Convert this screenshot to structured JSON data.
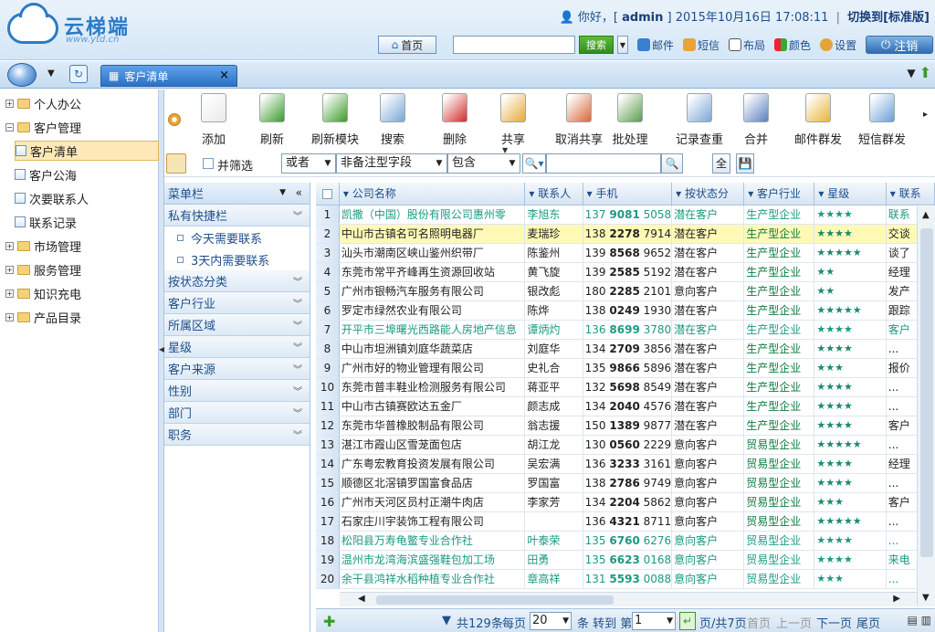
{
  "header": {
    "logo_title": "云梯端",
    "logo_url": "www.ytd.cn",
    "greeting": "你好，",
    "username": "admin",
    "datetime": "2015年10月16日 17:08:11",
    "switch_label": "切换到[标准版]",
    "home_label": "首页",
    "search_label": "搜索",
    "links": {
      "mail": "邮件",
      "sms": "短信",
      "layout": "布局",
      "color": "颜色",
      "settings": "设置"
    },
    "logout_label": "注销"
  },
  "tabs": {
    "active": "客户清单"
  },
  "sidebar": {
    "items": [
      {
        "label": "个人办公",
        "type": "folder"
      },
      {
        "label": "客户管理",
        "type": "folder-open"
      },
      {
        "label": "客户清单",
        "type": "doc"
      },
      {
        "label": "客户公海",
        "type": "doc"
      },
      {
        "label": "次要联系人",
        "type": "doc"
      },
      {
        "label": "联系记录",
        "type": "doc"
      },
      {
        "label": "市场管理",
        "type": "folder"
      },
      {
        "label": "服务管理",
        "type": "folder"
      },
      {
        "label": "知识充电",
        "type": "folder"
      },
      {
        "label": "产品目录",
        "type": "folder"
      }
    ]
  },
  "toolbar": {
    "buttons": [
      {
        "label": "添加",
        "icon": "add-doc-icon",
        "color": "#e9e9e9"
      },
      {
        "label": "刷新",
        "icon": "refresh-icon",
        "color": "#3a9a2a"
      },
      {
        "label": "刷新模块",
        "icon": "refresh-module-icon",
        "color": "#3a9a2a"
      },
      {
        "label": "搜索",
        "icon": "magnifier-icon",
        "color": "#7ba6d4"
      },
      {
        "label": "删除",
        "icon": "delete-icon",
        "color": "#d12c2c"
      },
      {
        "label": "共享",
        "icon": "share-icon",
        "color": "#e6a93a"
      },
      {
        "label": "取消共享",
        "icon": "unshare-icon",
        "color": "#d8673a"
      },
      {
        "label": "批处理",
        "icon": "batch-icon",
        "color": "#5c9b4b"
      },
      {
        "label": "记录查重",
        "icon": "dup-check-icon",
        "color": "#7ba6d4"
      },
      {
        "label": "合并",
        "icon": "merge-icon",
        "color": "#5b7fbf"
      },
      {
        "label": "邮件群发",
        "icon": "mail-send-icon",
        "color": "#e8b33a"
      },
      {
        "label": "短信群发",
        "icon": "sms-send-icon",
        "color": "#6a9ed6"
      }
    ]
  },
  "filter": {
    "checkbox_label": "并筛选",
    "logic": "或者",
    "field": "非备注型字段",
    "operator": "包含",
    "all_label": "全"
  },
  "menu": {
    "title": "菜单栏",
    "sections": [
      {
        "label": "私有快捷栏",
        "subs": [
          "今天需要联系",
          "3天内需要联系"
        ]
      },
      {
        "label": "按状态分类"
      },
      {
        "label": "客户行业"
      },
      {
        "label": "所属区域"
      },
      {
        "label": "星级"
      },
      {
        "label": "客户来源"
      },
      {
        "label": "性别"
      },
      {
        "label": "部门"
      },
      {
        "label": "职务"
      }
    ]
  },
  "grid": {
    "columns": [
      "公司名称",
      "联系人",
      "手机",
      "按状态分",
      "客户行业",
      "星级",
      "联系"
    ],
    "rows": [
      {
        "n": "1",
        "company": "凯撒（中国）股份有限公司惠州零",
        "contact": "李旭东",
        "p1": "137",
        "p2": "9081",
        "p3": "5058",
        "status": "潜在客户",
        "industry": "生产型企业",
        "star": "★★★★",
        "extra": "联系",
        "style": "teal"
      },
      {
        "n": "2",
        "company": "中山市古镇名可名照明电器厂",
        "contact": "麦瑞珍",
        "p1": "138",
        "p2": "2278",
        "p3": "7914",
        "status": "潜在客户",
        "industry": "生产型企业",
        "star": "★★★★",
        "extra": "交谈",
        "style": "hl"
      },
      {
        "n": "3",
        "company": "汕头市潮南区峡山鉴州织带厂",
        "contact": "陈鉴州",
        "p1": "139",
        "p2": "8568",
        "p3": "9652",
        "status": "潜在客户",
        "industry": "生产型企业",
        "star": "★★★★★",
        "extra": "谈了",
        "style": ""
      },
      {
        "n": "4",
        "company": "东莞市常平齐峰再生资源回收站",
        "contact": "黄飞旋",
        "p1": "139",
        "p2": "2585",
        "p3": "5192",
        "status": "潜在客户",
        "industry": "生产型企业",
        "star": "★★",
        "extra": "经理",
        "style": ""
      },
      {
        "n": "5",
        "company": "广州市银畅汽车服务有限公司",
        "contact": "银改彪",
        "p1": "180",
        "p2": "2285",
        "p3": "2101",
        "status": "意向客户",
        "industry": "生产型企业",
        "star": "★★",
        "extra": "发产",
        "style": ""
      },
      {
        "n": "6",
        "company": "罗定市绿然农业有限公司",
        "contact": "陈烨",
        "p1": "138",
        "p2": "0249",
        "p3": "1930",
        "status": "潜在客户",
        "industry": "生产型企业",
        "star": "★★★★★",
        "extra": "跟踪",
        "style": ""
      },
      {
        "n": "7",
        "company": "开平市三埠曙光西路能人房地产信息",
        "contact": "谭炳灼",
        "p1": "136",
        "p2": "8699",
        "p3": "3780",
        "status": "潜在客户",
        "industry": "生产型企业",
        "star": "★★★★",
        "extra": "客户",
        "style": "teal"
      },
      {
        "n": "8",
        "company": "中山市坦洲镇刘庭华蔬菜店",
        "contact": "刘庭华",
        "p1": "134",
        "p2": "2709",
        "p3": "3856",
        "status": "潜在客户",
        "industry": "生产型企业",
        "star": "★★★★",
        "extra": "...",
        "style": ""
      },
      {
        "n": "9",
        "company": "广州市好的物业管理有限公司",
        "contact": "史礼合",
        "p1": "135",
        "p2": "9866",
        "p3": "5896",
        "status": "潜在客户",
        "industry": "生产型企业",
        "star": "★★★",
        "extra": "报价",
        "style": ""
      },
      {
        "n": "10",
        "company": "东莞市普丰鞋业检测服务有限公司",
        "contact": "蒋亚平",
        "p1": "132",
        "p2": "5698",
        "p3": "8549",
        "status": "潜在客户",
        "industry": "生产型企业",
        "star": "★★★★",
        "extra": "...",
        "style": ""
      },
      {
        "n": "11",
        "company": "中山市古镇赛欧达五金厂",
        "contact": "颜志成",
        "p1": "134",
        "p2": "2040",
        "p3": "4576",
        "status": "潜在客户",
        "industry": "生产型企业",
        "star": "★★★★",
        "extra": "...",
        "style": ""
      },
      {
        "n": "12",
        "company": "东莞市华普橡胶制品有限公司",
        "contact": "翁志援",
        "p1": "150",
        "p2": "1389",
        "p3": "9877",
        "status": "潜在客户",
        "industry": "生产型企业",
        "star": "★★★★",
        "extra": "客户",
        "style": ""
      },
      {
        "n": "13",
        "company": "湛江市霞山区雪茏面包店",
        "contact": "胡江龙",
        "p1": "130",
        "p2": "0560",
        "p3": "2229",
        "status": "意向客户",
        "industry": "贸易型企业",
        "star": "★★★★★",
        "extra": "...",
        "style": ""
      },
      {
        "n": "14",
        "company": "广东粤宏教育投资发展有限公司",
        "contact": "吴宏满",
        "p1": "136",
        "p2": "3233",
        "p3": "3161",
        "status": "意向客户",
        "industry": "贸易型企业",
        "star": "★★★★",
        "extra": "经理",
        "style": ""
      },
      {
        "n": "15",
        "company": "顺德区北滘镇罗国富食品店",
        "contact": "罗国富",
        "p1": "138",
        "p2": "2786",
        "p3": "9749",
        "status": "意向客户",
        "industry": "贸易型企业",
        "star": "★★★★",
        "extra": "...",
        "style": ""
      },
      {
        "n": "16",
        "company": "广州市天河区员村正潮牛肉店",
        "contact": "李家芳",
        "p1": "134",
        "p2": "2204",
        "p3": "5862",
        "status": "意向客户",
        "industry": "贸易型企业",
        "star": "★★★",
        "extra": "客户",
        "style": ""
      },
      {
        "n": "17",
        "company": "石家庄川宇装饰工程有限公司",
        "contact": "",
        "p1": "136",
        "p2": "4321",
        "p3": "8711",
        "status": "意向客户",
        "industry": "贸易型企业",
        "star": "★★★★★",
        "extra": "...",
        "style": ""
      },
      {
        "n": "18",
        "company": "松阳县万寿龟鳖专业合作社",
        "contact": "叶泰荣",
        "p1": "135",
        "p2": "6760",
        "p3": "6276",
        "status": "意向客户",
        "industry": "贸易型企业",
        "star": "★★★★",
        "extra": "...",
        "style": "teal"
      },
      {
        "n": "19",
        "company": "温州市龙湾海滨盛强鞋包加工场",
        "contact": "田勇",
        "p1": "135",
        "p2": "6623",
        "p3": "0168",
        "status": "意向客户",
        "industry": "贸易型企业",
        "star": "★★★★",
        "extra": "来电",
        "style": "teal"
      },
      {
        "n": "20",
        "company": "余干县鸿祥水稻种植专业合作社",
        "contact": "章高祥",
        "p1": "131",
        "p2": "5593",
        "p3": "0088",
        "status": "意向客户",
        "industry": "贸易型企业",
        "star": "★★★",
        "extra": "...",
        "style": "teal"
      }
    ]
  },
  "pager": {
    "total": "共129条",
    "per_page_label": "每页",
    "per_page": "20",
    "goto_label": "条 转到 第",
    "page": "1",
    "pages": "页/共7页",
    "first": "首页",
    "prev": "上一页",
    "next": "下一页",
    "last": "尾页"
  }
}
